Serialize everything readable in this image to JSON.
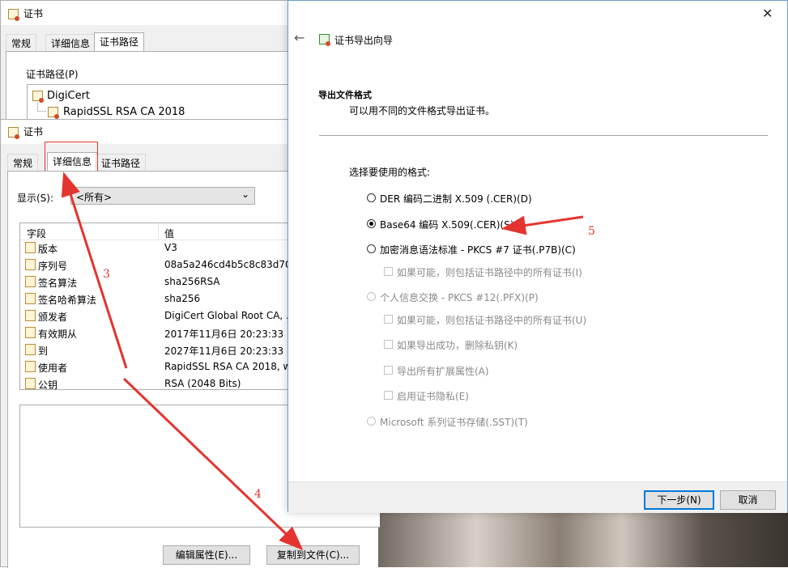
{
  "back_window": {
    "title": "证书",
    "tabs": [
      "常规",
      "详细信息",
      "证书路径"
    ],
    "path_label": "证书路径(P)",
    "path_items": [
      "DigiCert",
      "RapidSSL RSA CA 2018"
    ]
  },
  "front_window": {
    "title": "证书",
    "tabs": [
      "常规",
      "详细信息",
      "证书路径"
    ],
    "show_label": "显示(S):",
    "show_value": "<所有>",
    "columns": [
      "字段",
      "值"
    ],
    "rows": [
      {
        "field": "版本",
        "value": "V3"
      },
      {
        "field": "序列号",
        "value": "08a5a246cd4b5c8c83d70..."
      },
      {
        "field": "签名算法",
        "value": "sha256RSA"
      },
      {
        "field": "签名哈希算法",
        "value": "sha256"
      },
      {
        "field": "颁发者",
        "value": "DigiCert Global Root CA, ..."
      },
      {
        "field": "有效期从",
        "value": "2017年11月6日 20:23:33"
      },
      {
        "field": "到",
        "value": "2027年11月6日 20:23:33"
      },
      {
        "field": "使用者",
        "value": "RapidSSL RSA CA 2018, w..."
      },
      {
        "field": "公钥",
        "value": "RSA (2048 Bits)"
      }
    ],
    "edit_button": "编辑属性(E)...",
    "copy_button": "复制到文件(C)..."
  },
  "wizard": {
    "title": "证书导出向导",
    "heading": "导出文件格式",
    "subheading": "可以用不同的文件格式导出证书。",
    "select_label": "选择要使用的格式:",
    "options": [
      {
        "label": "DER 编码二进制 X.509 (.CER)(D)",
        "checked": false,
        "disabled": false
      },
      {
        "label": "Base64 编码 X.509(.CER)(S)",
        "checked": true,
        "disabled": false
      },
      {
        "label": "加密消息语法标准 - PKCS #7 证书(.P7B)(C)",
        "checked": false,
        "disabled": false
      },
      {
        "label": "个人信息交换 - PKCS #12(.PFX)(P)",
        "checked": false,
        "disabled": true
      },
      {
        "label": "Microsoft 系列证书存储(.SST)(T)",
        "checked": false,
        "disabled": true
      }
    ],
    "sub_options": [
      "如果可能，则包括证书路径中的所有证书(I)",
      "如果可能，则包括证书路径中的所有证书(U)",
      "如果导出成功，删除私钥(K)",
      "导出所有扩展属性(A)",
      "启用证书隐私(E)"
    ],
    "next_button": "下一步(N)",
    "cancel_button": "取消"
  },
  "annotations": [
    "3",
    "4",
    "5"
  ],
  "colors": {
    "accent": "#0078d7",
    "annotation": "#e3342f",
    "window_bg": "#f0f0f0"
  }
}
